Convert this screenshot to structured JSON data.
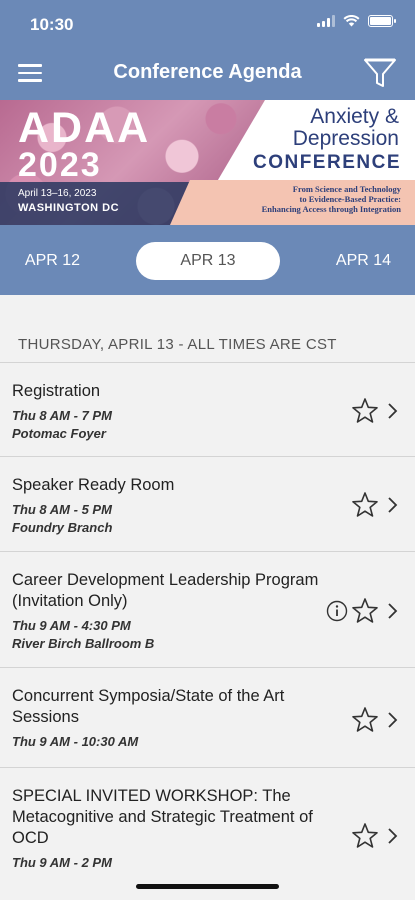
{
  "status_bar": {
    "time": "10:30"
  },
  "header": {
    "title": "Conference Agenda",
    "menu_icon": "hamburger-icon",
    "filter_icon": "funnel-icon"
  },
  "banner": {
    "name": "ADAA",
    "year": "2023",
    "dates": "April 13–16, 2023",
    "city": "WASHINGTON DC",
    "title_line1": "Anxiety &",
    "title_line2": "Depression",
    "title_line3": "CONFERENCE",
    "tagline1": "From Science and Technology",
    "tagline2": "to Evidence-Based Practice:",
    "tagline3": "Enhancing Access through Integration"
  },
  "date_tabs": [
    {
      "label": "APR 12",
      "active": false
    },
    {
      "label": "APR 13",
      "active": true
    },
    {
      "label": "APR 14",
      "active": false
    }
  ],
  "day_header": "THURSDAY, APRIL 13 - ALL TIMES ARE CST",
  "sessions": [
    {
      "title": "Registration",
      "time": "Thu 8 AM - 7 PM",
      "location": "Potomac Foyer",
      "has_info": false
    },
    {
      "title": "Speaker Ready Room",
      "time": "Thu 8 AM - 5 PM",
      "location": "Foundry Branch",
      "has_info": false
    },
    {
      "title": "Career Development Leadership Program (Invitation Only)",
      "time": "Thu 9 AM - 4:30 PM",
      "location": "River Birch Ballroom B",
      "has_info": true
    },
    {
      "title": "Concurrent Symposia/State of the Art Sessions",
      "time": "Thu 9 AM - 10:30 AM",
      "location": "",
      "has_info": false
    },
    {
      "title": "SPECIAL INVITED WORKSHOP: The Metacognitive and Strategic Treatment of OCD",
      "time": "Thu 9 AM - 2 PM",
      "location": "",
      "has_info": false
    }
  ],
  "colors": {
    "header_bg": "#6b89b7",
    "list_bg": "#f2f2f2",
    "banner_navy": "#2d3f7a"
  }
}
